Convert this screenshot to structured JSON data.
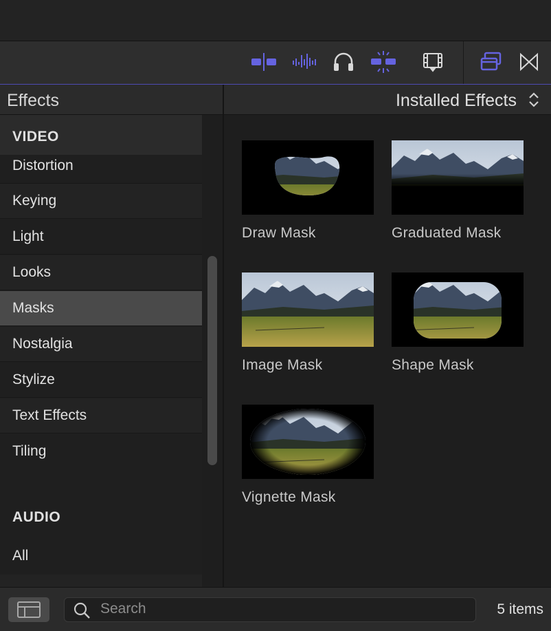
{
  "colors": {
    "accent": "#6563e0",
    "selection": "#4a4a4a"
  },
  "toolbar": {
    "icons": [
      "split-clip-icon",
      "audio-waveform-icon",
      "headphones-icon",
      "snapping-icon",
      "filmstrip-icon",
      "stacked-windows-icon",
      "transitions-icon"
    ]
  },
  "browser": {
    "sidebar_title": "Effects",
    "filter_label": "Installed Effects"
  },
  "sidebar": {
    "video_header": "VIDEO",
    "items": [
      "Distortion",
      "Keying",
      "Light",
      "Looks",
      "Masks",
      "Nostalgia",
      "Stylize",
      "Text Effects",
      "Tiling"
    ],
    "selected": "Masks",
    "audio_header": "AUDIO",
    "audio_items": [
      "All"
    ]
  },
  "effects": [
    {
      "label": "Draw Mask"
    },
    {
      "label": "Graduated Mask"
    },
    {
      "label": "Image Mask"
    },
    {
      "label": "Shape Mask"
    },
    {
      "label": "Vignette Mask"
    }
  ],
  "search": {
    "placeholder": "Search"
  },
  "status": {
    "count": "5 items"
  }
}
